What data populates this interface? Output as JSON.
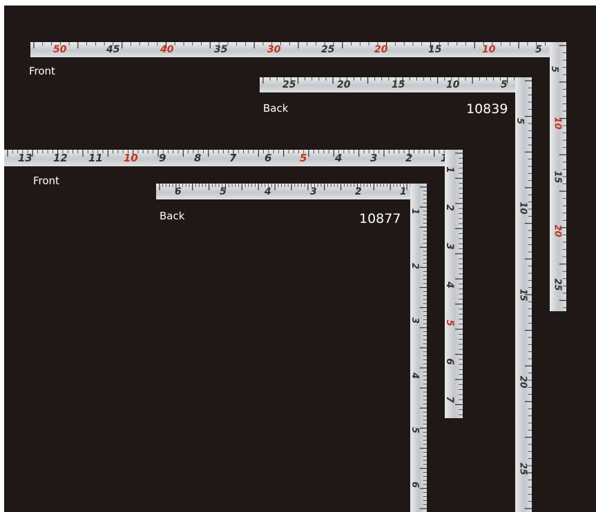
{
  "captions": {
    "square_10839": {
      "front": "Front",
      "back": "Back",
      "model": "10839"
    },
    "square_10877": {
      "front": "Front",
      "back": "Back",
      "model": "10877"
    }
  },
  "colors": {
    "background": "#201816",
    "steel": "#d4d6d9",
    "tick": "#2c2c2c",
    "red_numeral": "#c2341f"
  },
  "rulers": {
    "r10839_front_top": [
      {
        "t": "50",
        "red": true
      },
      {
        "t": "45"
      },
      {
        "t": "40",
        "red": true
      },
      {
        "t": "35"
      },
      {
        "t": "30",
        "red": true
      },
      {
        "t": "25"
      },
      {
        "t": "20",
        "red": true
      },
      {
        "t": "15"
      },
      {
        "t": "10",
        "red": true
      },
      {
        "t": "5"
      }
    ],
    "r10839_front_vertical": [
      {
        "t": "5"
      },
      {
        "t": "10",
        "red": true
      },
      {
        "t": "15"
      },
      {
        "t": "20",
        "red": true
      },
      {
        "t": "25"
      }
    ],
    "r10839_back_top": [
      {
        "t": "25"
      },
      {
        "t": "20"
      },
      {
        "t": "15"
      },
      {
        "t": "10"
      },
      {
        "t": "5"
      }
    ],
    "r10839_back_vertical": [
      {
        "t": "5"
      },
      {
        "t": "10"
      },
      {
        "t": "15"
      },
      {
        "t": "20"
      },
      {
        "t": "25"
      }
    ],
    "r10877_front_top": [
      {
        "t": "13"
      },
      {
        "t": "12"
      },
      {
        "t": "11"
      },
      {
        "t": "10",
        "red": true
      },
      {
        "t": "9"
      },
      {
        "t": "8"
      },
      {
        "t": "7"
      },
      {
        "t": "6"
      },
      {
        "t": "5",
        "red": true
      },
      {
        "t": "4"
      },
      {
        "t": "3"
      },
      {
        "t": "2"
      },
      {
        "t": "1"
      }
    ],
    "r10877_front_vertical": [
      {
        "t": "1"
      },
      {
        "t": "2"
      },
      {
        "t": "3"
      },
      {
        "t": "4"
      },
      {
        "t": "5",
        "red": true
      },
      {
        "t": "6"
      },
      {
        "t": "7"
      }
    ],
    "r10877_back_top": [
      {
        "t": "6"
      },
      {
        "t": "5"
      },
      {
        "t": "4"
      },
      {
        "t": "3"
      },
      {
        "t": "2"
      },
      {
        "t": "1"
      }
    ],
    "r10877_back_vertical": [
      {
        "t": "1"
      },
      {
        "t": "2"
      },
      {
        "t": "3"
      },
      {
        "t": "4"
      },
      {
        "t": "5"
      },
      {
        "t": "6"
      }
    ]
  }
}
